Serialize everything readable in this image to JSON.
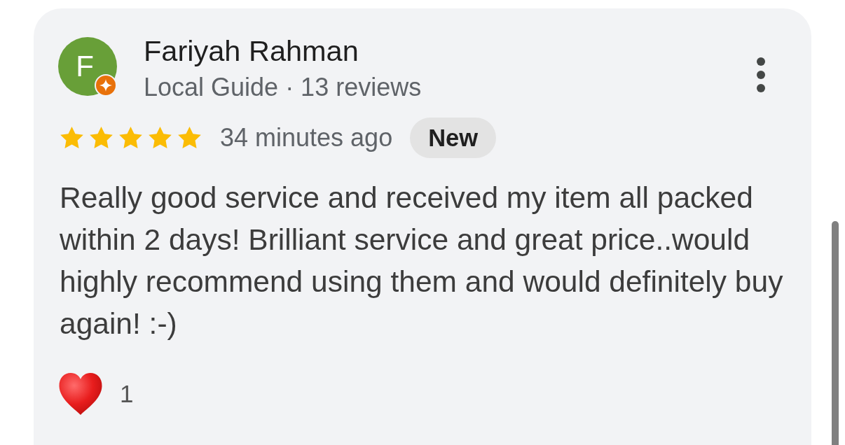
{
  "review": {
    "author": {
      "initial": "F",
      "name": "Fariyah Rahman",
      "subtitle": "Local Guide · 13 reviews",
      "local_guide": true
    },
    "stars": 5,
    "time": "34 minutes ago",
    "badge": "New",
    "text": "Really good service and received my item all packed within 2 days! Brilliant service and great price..would highly recommend using them and would definitely buy again! :-)",
    "reactions": [
      {
        "kind": "heart",
        "count": "1"
      }
    ]
  }
}
